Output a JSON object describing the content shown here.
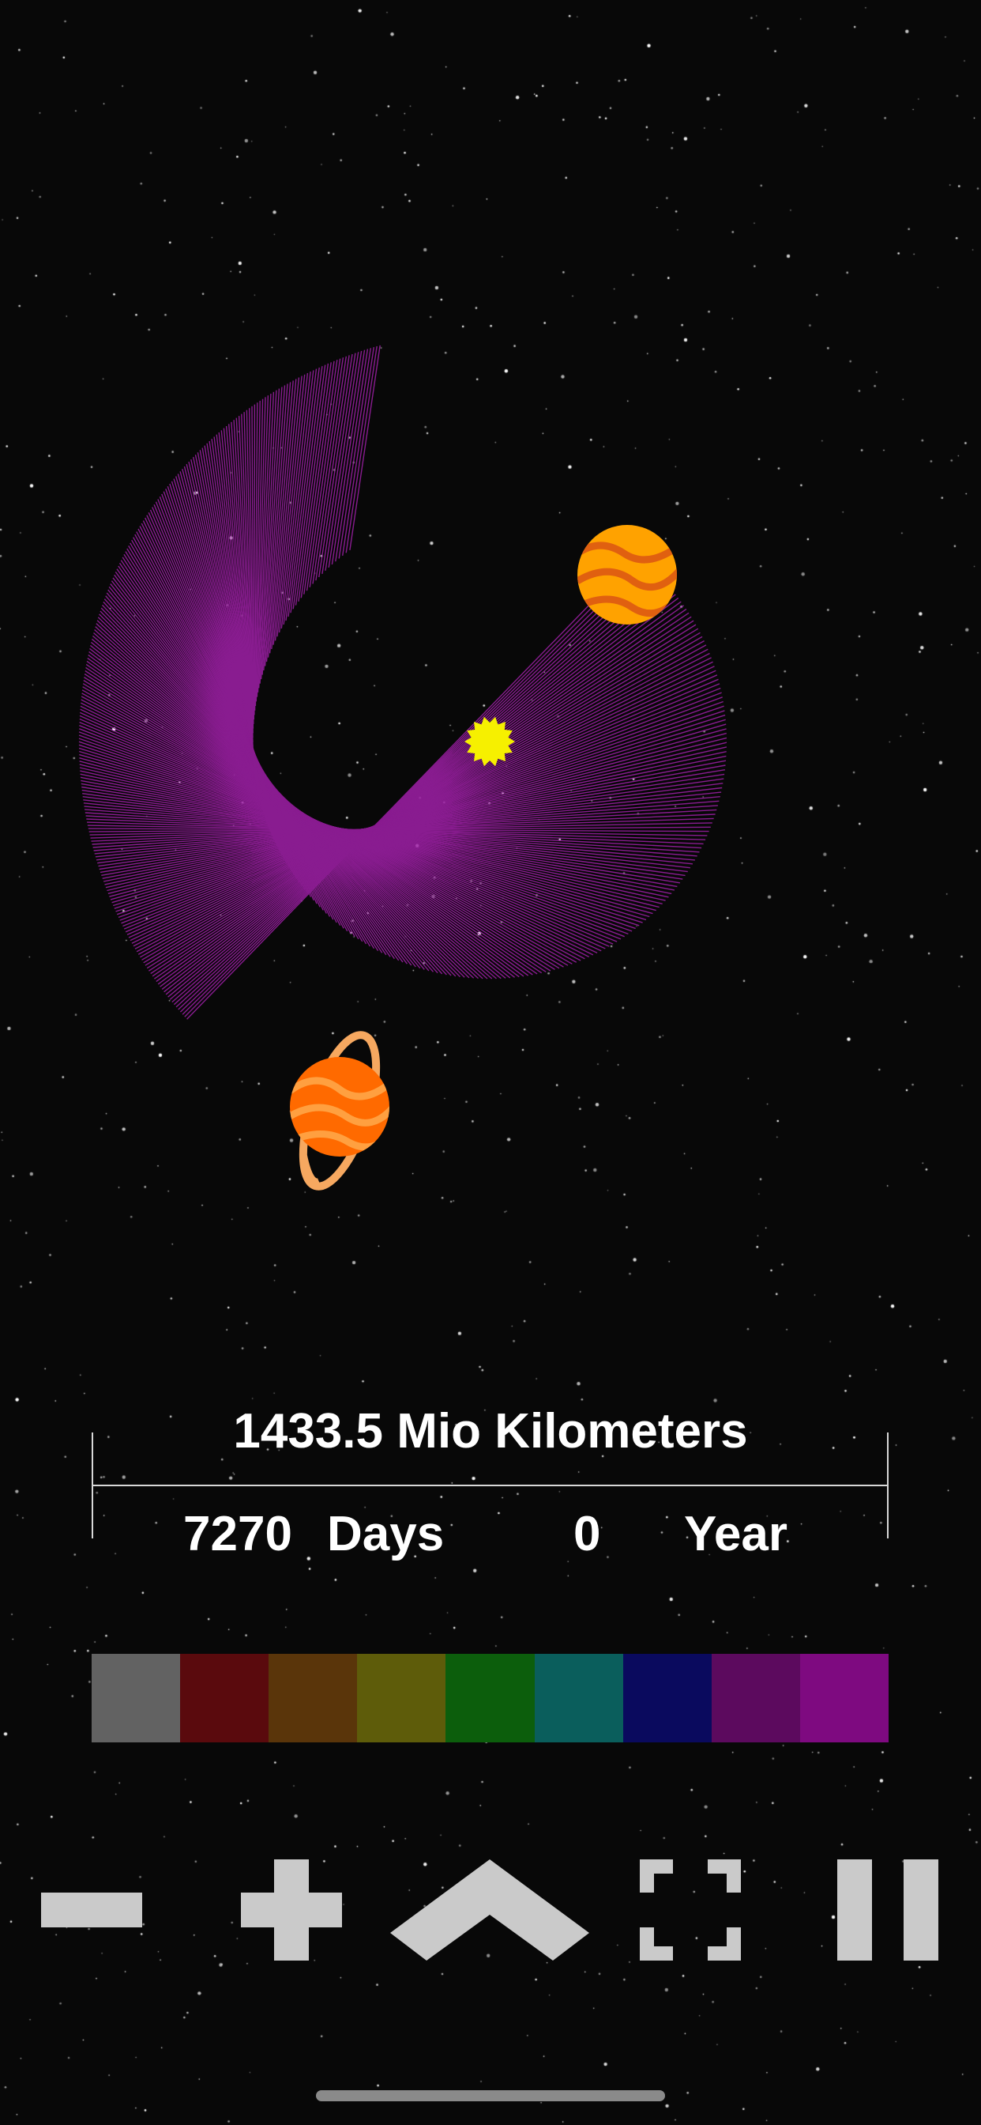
{
  "stats": {
    "distance": "1433.5 Mio Kilometers",
    "days_value": "7270",
    "days_label": "Days",
    "year_value": "0",
    "year_label": "Year"
  },
  "palette": [
    "#626262",
    "#5a0a0d",
    "#5a350a",
    "#5e5c0a",
    "#0c5e0c",
    "#0a5e5c",
    "#0a0a5e",
    "#5c0a5e",
    "#7e0a80"
  ],
  "colors": {
    "line": "#a020a8",
    "sun": "#f6f000",
    "jupiter": "#ffa200",
    "jupiter_band": "#e06010",
    "saturn": "#ff6a00",
    "saturn_band": "#ffa040",
    "ring": "#f6a860",
    "button": "#cacaca"
  },
  "icons": {
    "zoom_out": "minus-icon",
    "zoom_in": "plus-icon",
    "collapse": "chevron-up-icon",
    "fullscreen": "fullscreen-icon",
    "pause": "pause-icon"
  }
}
